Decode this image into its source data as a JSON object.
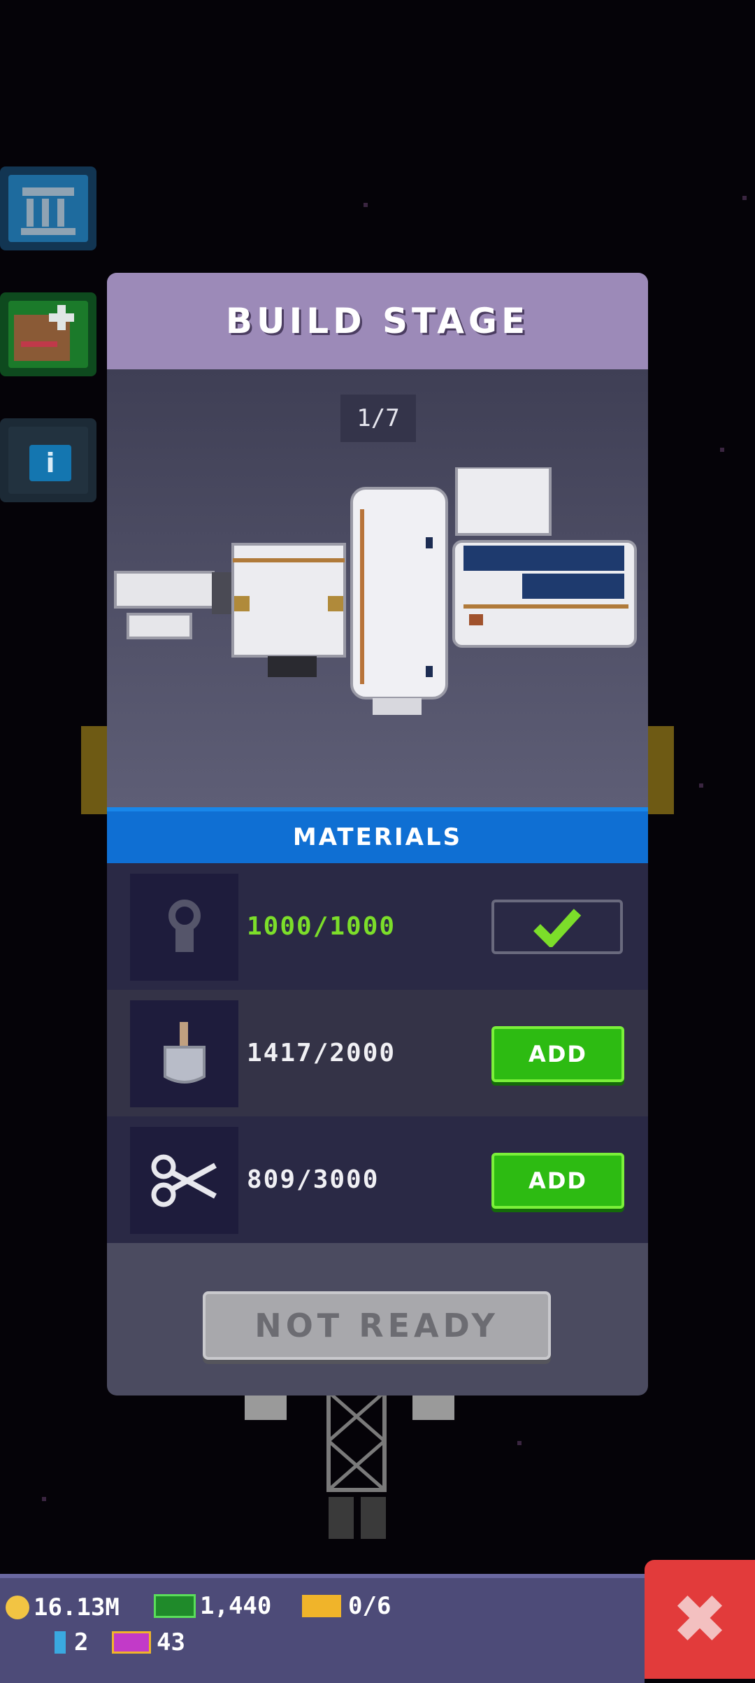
{
  "modal": {
    "title": "BUILD STAGE",
    "stage_counter": "1/7",
    "materials_title": "MATERIALS",
    "materials": [
      {
        "icon": "ring-icon",
        "count": "1000/1000",
        "state": "complete"
      },
      {
        "icon": "shovel-icon",
        "count": "1417/2000",
        "action": "ADD"
      },
      {
        "icon": "scissors-icon",
        "count": "809/3000",
        "action": "ADD"
      }
    ],
    "ready_button": "NOT READY"
  },
  "resources": {
    "coins": "16.13M",
    "cash": "1,440",
    "tickets": "0/6",
    "gems": "2",
    "premium": "43"
  },
  "colors": {
    "header": "#9c8ab8",
    "materials_header": "#0f6fd3",
    "add_button": "#2dbb12",
    "close_button": "#e23b3b"
  }
}
